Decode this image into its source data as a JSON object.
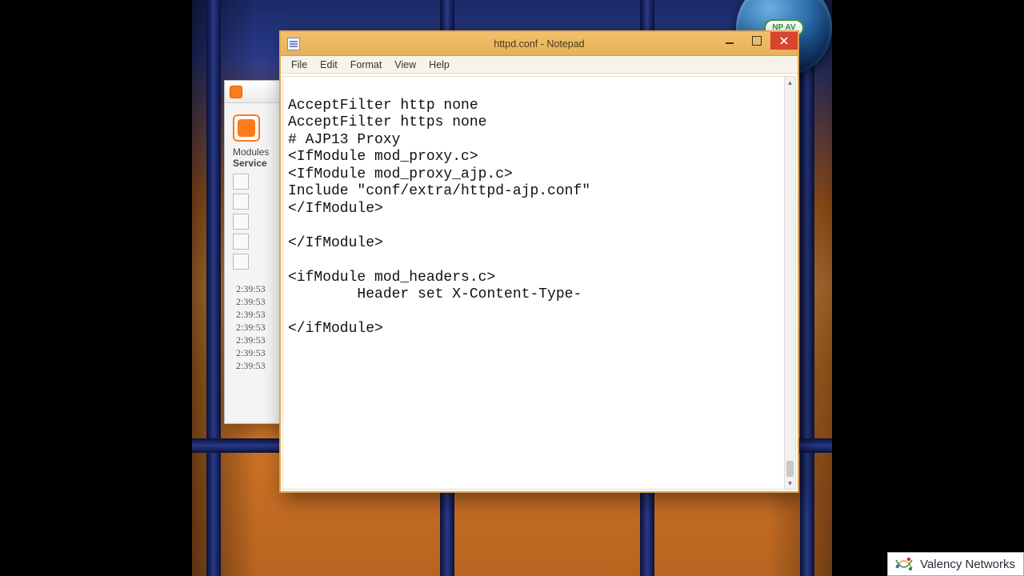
{
  "widget": {
    "badge": "NP AV"
  },
  "xampp": {
    "header_modules": "Modules",
    "header_service": "Service",
    "log_times": [
      "2:39:53",
      "2:39:53",
      "2:39:53",
      "2:39:53",
      "2:39:53",
      "2:39:53",
      "2:39:53"
    ]
  },
  "notepad": {
    "title": "httpd.conf - Notepad",
    "menu": {
      "file": "File",
      "edit": "Edit",
      "format": "Format",
      "view": "View",
      "help": "Help"
    },
    "content": "\nAcceptFilter http none\nAcceptFilter https none\n# AJP13 Proxy\n<IfModule mod_proxy.c>\n<IfModule mod_proxy_ajp.c>\nInclude \"conf/extra/httpd-ajp.conf\"\n</IfModule>\n\n</IfModule>\n\n<ifModule mod_headers.c>\n        Header set X-Content-Type-\n\n</ifModule>\n"
  },
  "watermark": {
    "text": "Valency Networks"
  }
}
